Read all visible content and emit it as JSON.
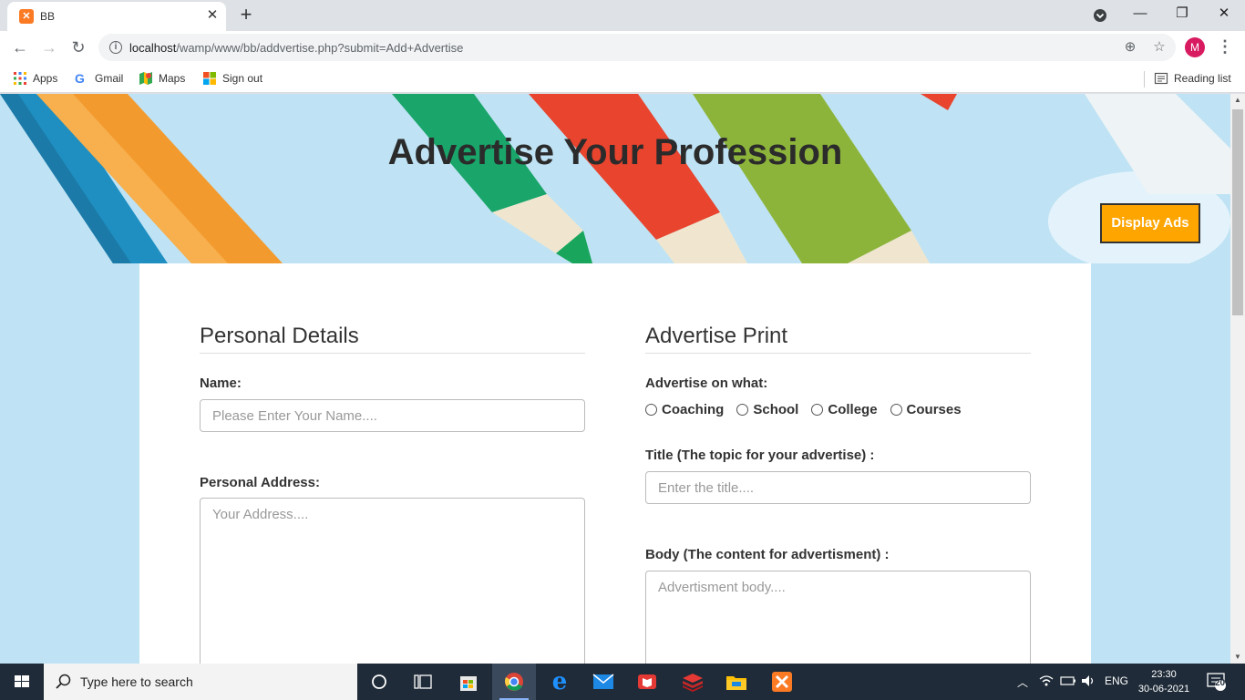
{
  "browser": {
    "tab_title": "BB",
    "url_host": "localhost",
    "url_path": "/wamp/www/bb/addvertise.php?submit=Add+Advertise",
    "profile_initial": "M",
    "bookmarks": [
      "Apps",
      "Gmail",
      "Maps",
      "Sign out"
    ],
    "reading_list": "Reading list"
  },
  "page": {
    "title": "Advertise Your Profession",
    "display_ads_label": "Display Ads",
    "personal": {
      "heading": "Personal Details",
      "name_label": "Name:",
      "name_placeholder": "Please Enter Your Name....",
      "address_label": "Personal Address:",
      "address_placeholder": "Your Address...."
    },
    "advertise": {
      "heading": "Advertise Print",
      "on_what_label": "Advertise on what:",
      "options": [
        "Coaching",
        "School",
        "College",
        "Courses"
      ],
      "title_label": "Title (The topic for your advertise) :",
      "title_placeholder": "Enter the title....",
      "body_label": "Body (The content for advertisment) :",
      "body_placeholder": "Advertisment body...."
    }
  },
  "taskbar": {
    "search_placeholder": "Type here to search",
    "language": "ENG",
    "time": "23:30",
    "date": "30-06-2021",
    "notification_count": "20"
  },
  "colors": {
    "display_ads_bg": "#ffa500",
    "page_bg": "#bfe3f4",
    "taskbar_bg": "#1f2b38"
  }
}
